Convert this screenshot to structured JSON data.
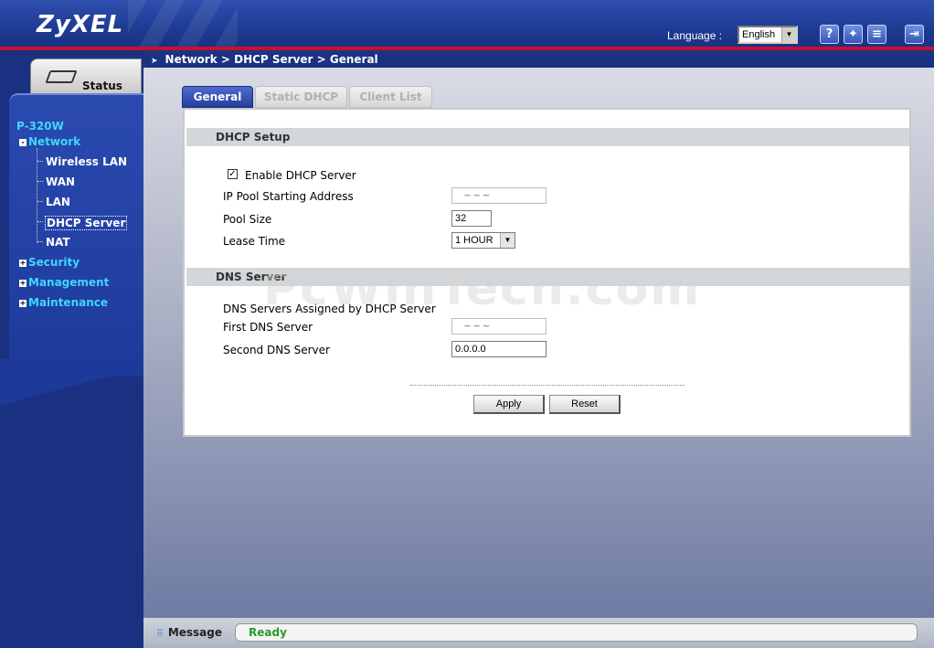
{
  "header": {
    "logo": "ZyXEL",
    "language_label": "Language :",
    "language_value": "English",
    "icons": [
      "help-icon",
      "wizard-icon",
      "notes-icon",
      "logout-icon"
    ]
  },
  "breadcrumb": "Network > DHCP Server > General",
  "sidebar": {
    "status_label": "Status",
    "device": "P-320W",
    "items": [
      {
        "label": "Network",
        "expand": "-"
      },
      {
        "label": "Wireless LAN"
      },
      {
        "label": "WAN"
      },
      {
        "label": "LAN"
      },
      {
        "label": "DHCP Server"
      },
      {
        "label": "NAT"
      },
      {
        "label": "Security",
        "expand": "+"
      },
      {
        "label": "Management",
        "expand": "+"
      },
      {
        "label": "Maintenance",
        "expand": "+"
      }
    ]
  },
  "tabs": [
    {
      "label": "General"
    },
    {
      "label": "Static DHCP"
    },
    {
      "label": "Client List"
    }
  ],
  "dhcp_setup": {
    "title": "DHCP Setup",
    "enable_label": "Enable DHCP Server",
    "enable_checked": "✓",
    "ip_pool_label": "IP Pool Starting Address",
    "ip_pool_value": "~~~",
    "pool_size_label": "Pool Size",
    "pool_size_value": "32",
    "lease_label": "Lease Time",
    "lease_value": "1 HOUR"
  },
  "dns_server": {
    "title": "DNS Server",
    "assigned_label": "DNS Servers Assigned by DHCP Server",
    "first_label": "First DNS Server",
    "first_value": "~~~",
    "second_label": "Second DNS Server",
    "second_value": "0.0.0.0"
  },
  "buttons": {
    "apply": "Apply",
    "reset": "Reset"
  },
  "watermark": "PcWinTech.com",
  "statusbar": {
    "label": "Message",
    "value": "Ready"
  },
  "colors": {
    "header_bg": "#1d3a92",
    "accent_red": "#c8102e",
    "nav_cyan": "#3fd7ff",
    "status_green": "#2a9a2a"
  }
}
